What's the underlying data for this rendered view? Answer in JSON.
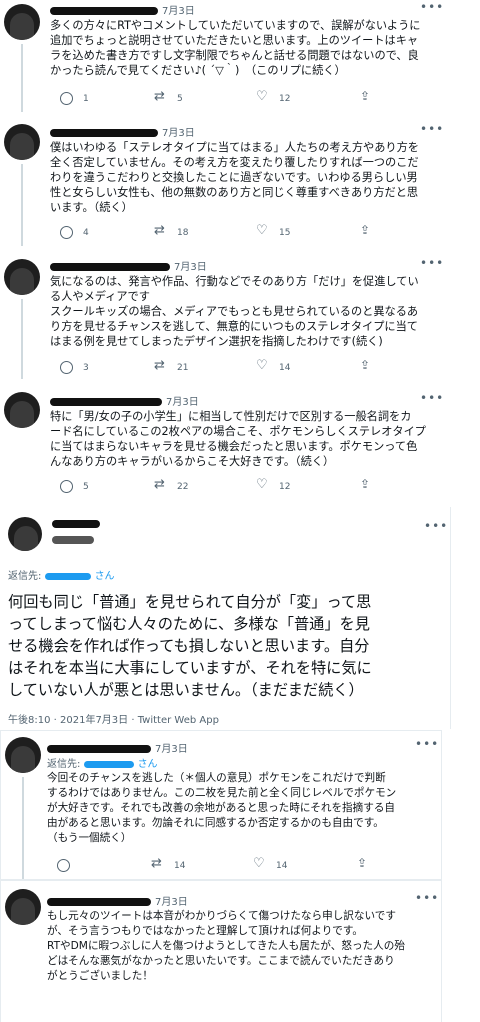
{
  "tweets": [
    {
      "date": "7月3日",
      "text": "多くの方々にRTやコメントしていただいていますので、誤解がないように\n追加でちょっと説明させていただきたいと思います。上のツイートはキャ\nラを込めた書き方ですし文字制限でちゃんと話せる問題ではないので、良\nかったら読んで見てください♪( ´▽｀)　（このリプに続く）",
      "replies": "1",
      "retweets": "5",
      "likes": "12"
    },
    {
      "date": "7月3日",
      "text": "僕はいわゆる「ステレオタイプに当てはまる」人たちの考え方やあり方を\n全く否定していません。その考え方を変えたり覆したりすれば一つのこだ\nわりを違うこだわりと交換したことに過ぎないです。いわゆる男らしい男\n性と女らしい女性も、他の無数のあり方と同じく尊重すべきあり方だと思\nいます。（続く）",
      "replies": "4",
      "retweets": "18",
      "likes": "15"
    },
    {
      "date": "7月3日",
      "text": "気になるのは、発言や作品、行動などでそのあり方「だけ」を促進してい\nる人やメディアです\nスクールキッズの場合、メディアでもっとも見せられているのと異なるあ\nり方を見せるチャンスを逃して、無意的にいつものステレオタイプに当て\nはまる例を見せてしまったデザイン選択を指摘したわけです(続く)",
      "replies": "3",
      "retweets": "21",
      "likes": "14"
    },
    {
      "date": "7月3日",
      "text": "特に「男/女の子の小学生」に相当して性別だけで区別する一般名詞をカ\nード名にしているこの2枚ペアの場合こそ、ポケモンらしくステレオタイプ\nに当てはまらないキャラを見せる機会だったと思います。ポケモンって色\nんなあり方のキャラがいるからこそ大好きです。（続く）",
      "replies": "5",
      "retweets": "22",
      "likes": "12"
    }
  ],
  "focus": {
    "reply_to_label": "返信先:",
    "reply_to_suffix": "さん",
    "text": "何回も同じ「普通」を見せられて自分が「変」って思\nってしまって悩む人々のために、多様な「普通」を見\nせる機会を作れば作っても損しないと思います。自分\nはそれを本当に大事にしていますが、それを特に気に\nしていない人が悪とは思いません。（まだまだ続く）",
    "meta": "午後8:10 · 2021年7月3日 · Twitter Web App"
  },
  "replies_after": [
    {
      "date": "7月3日",
      "reply_to_label": "返信先:",
      "reply_to_suffix": "さん",
      "text": "今回そのチャンスを逃した（＊個人の意見）ポケモンをこれだけで判断\nするわけではありません。この二枚を見た前と全く同じレベルでポケモン\nが大好きです。それでも改善の余地があると思った時にそれを指摘する自\n由があると思います。勿論それに同感するか否定するかのも自由です。\n（もう一個続く）",
      "replies": "",
      "retweets": "14",
      "likes": "14"
    },
    {
      "date": "7月3日",
      "text": "もし元々のツイートは本音がわかりづらくて傷つけたなら申し訳ないです\nが、そう言うつもりではなかったと理解して頂ければ何よりです。\nRTやDMに暇つぶしに人を傷つけようとしてきた人も居たが、怒った人の殆\nどはそんな悪気がなかったと思いたいです。ここまで読んでいただきあり\nがとうございました！"
    }
  ],
  "icons": [
    "reply-icon",
    "retweet-icon",
    "like-icon",
    "share-icon",
    "more-icon"
  ],
  "colors": {
    "link": "#1d9bf0",
    "muted": "#536471",
    "text": "#0f1419"
  }
}
